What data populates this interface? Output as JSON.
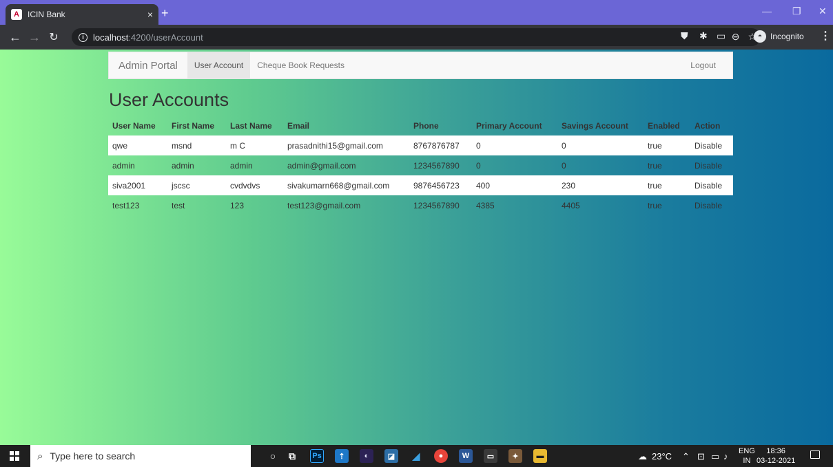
{
  "browser": {
    "tab_title": "ICIN Bank",
    "tab_favicon": "A",
    "tab_close": "×",
    "new_tab": "+",
    "url_host": "localhost",
    "url_path": ":4200/userAccount",
    "incognito_label": "Incognito",
    "window_controls": [
      "—",
      "❐",
      "✕"
    ]
  },
  "navbar": {
    "brand": "Admin Portal",
    "links": [
      "User Account",
      "Cheque Book Requests"
    ],
    "logout": "Logout"
  },
  "page": {
    "title": "User Accounts"
  },
  "table": {
    "headers": [
      "User Name",
      "First Name",
      "Last Name",
      "Email",
      "Phone",
      "Primary Account",
      "Savings Account",
      "Enabled",
      "Action"
    ],
    "rows": [
      {
        "user": "qwe",
        "first": "msnd",
        "last": "m C",
        "email": "prasadnithi15@gmail.com",
        "phone": "8767876787",
        "primary": "0",
        "savings": "0",
        "enabled": "true",
        "action": "Disable"
      },
      {
        "user": "admin",
        "first": "admin",
        "last": "admin",
        "email": "admin@gmail.com",
        "phone": "1234567890",
        "primary": "0",
        "savings": "0",
        "enabled": "true",
        "action": "Disable"
      },
      {
        "user": "siva2001",
        "first": "jscsc",
        "last": "cvdvdvs",
        "email": "sivakumarn668@gmail.com",
        "phone": "9876456723",
        "primary": "400",
        "savings": "230",
        "enabled": "true",
        "action": "Disable"
      },
      {
        "user": "test123",
        "first": "test",
        "last": "123",
        "email": "test123@gmail.com",
        "phone": "1234567890",
        "primary": "4385",
        "savings": "4405",
        "enabled": "true",
        "action": "Disable"
      }
    ]
  },
  "taskbar": {
    "search_placeholder": "Type here to search",
    "weather": "23°C",
    "lang_top": "ENG",
    "lang_bottom": "IN",
    "time": "18:36",
    "date": "03-12-2021"
  },
  "colors": {
    "accent_link": "#337ab7",
    "tabbar": "#6b66d6",
    "gradient_start": "#98fb98",
    "gradient_end": "#0a6a9e"
  }
}
